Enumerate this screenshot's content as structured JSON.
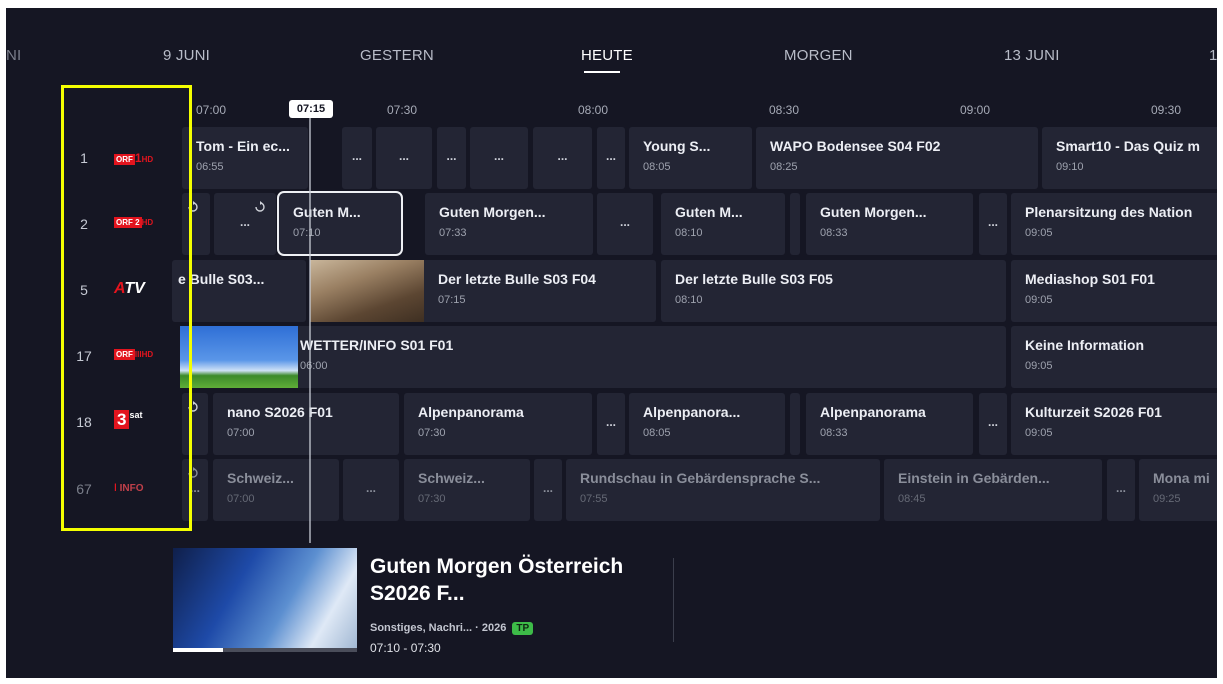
{
  "date_tabs": [
    {
      "label": "NI"
    },
    {
      "label": "9 JUNI"
    },
    {
      "label": "GESTERN"
    },
    {
      "label": "HEUTE",
      "active": true
    },
    {
      "label": "MORGEN"
    },
    {
      "label": "13 JUNI"
    },
    {
      "label": "1"
    }
  ],
  "timeline": {
    "current_time": "07:15",
    "ticks": [
      "07:00",
      "07:30",
      "08:00",
      "08:30",
      "09:00",
      "09:30"
    ]
  },
  "channels": [
    {
      "number": "1",
      "logo_text": "ORF 1 HD"
    },
    {
      "number": "2",
      "logo_text": "ORF 2 HD"
    },
    {
      "number": "5",
      "logo_text": "ATV"
    },
    {
      "number": "17",
      "logo_text": "ORF III HD"
    },
    {
      "number": "18",
      "logo_text": "3sat"
    },
    {
      "number": "67",
      "logo_text": "INFO"
    }
  ],
  "rows": [
    {
      "cells": [
        {
          "title": "Tom - Ein ec...",
          "time": "06:55"
        },
        {
          "title": "..."
        },
        {
          "title": "..."
        },
        {
          "title": "..."
        },
        {
          "title": "..."
        },
        {
          "title": "..."
        },
        {
          "title": "..."
        },
        {
          "title": "Young S...",
          "time": "08:05"
        },
        {
          "title": "WAPO Bodensee S04 F02",
          "time": "08:25"
        },
        {
          "title": "Smart10 - Das Quiz m",
          "time": "09:10"
        }
      ]
    },
    {
      "cells": [
        {
          "title": "..."
        },
        {
          "title": "Guten M...",
          "time": "07:10",
          "selected": true
        },
        {
          "title": "Guten Morgen...",
          "time": "07:33"
        },
        {
          "title": "..."
        },
        {
          "title": "Guten M...",
          "time": "08:10"
        },
        {
          "title": "Guten Morgen...",
          "time": "08:33"
        },
        {
          "title": "..."
        },
        {
          "title": "Plenarsitzung des Nation",
          "time": "09:05"
        }
      ]
    },
    {
      "cells": [
        {
          "title": "e Bulle S03..."
        },
        {
          "title": "Der letzte Bulle S03 F04",
          "time": "07:15"
        },
        {
          "title": "Der letzte Bulle S03 F05",
          "time": "08:10"
        },
        {
          "title": "Mediashop S01 F01",
          "time": "09:05"
        }
      ]
    },
    {
      "cells": [
        {
          "title": "WETTER/INFO S01 F01",
          "time": "06:00"
        },
        {
          "title": "Keine Information",
          "time": "09:05"
        }
      ]
    },
    {
      "cells": [
        {
          "title": "nano S2026 F01",
          "time": "07:00"
        },
        {
          "title": "Alpenpanorama",
          "time": "07:30"
        },
        {
          "title": "..."
        },
        {
          "title": "Alpenpanora...",
          "time": "08:05"
        },
        {
          "title": "Alpenpanorama",
          "time": "08:33"
        },
        {
          "title": "..."
        },
        {
          "title": "Kulturzeit S2026 F01",
          "time": "09:05"
        }
      ]
    },
    {
      "cells": [
        {
          "title": "..."
        },
        {
          "title": "Schweiz...",
          "time": "07:00"
        },
        {
          "title": "..."
        },
        {
          "title": "Schweiz...",
          "time": "07:30"
        },
        {
          "title": "..."
        },
        {
          "title": "Rundschau in Gebärdensprache S...",
          "time": "07:55"
        },
        {
          "title": "Einstein in Gebärden...",
          "time": "08:45"
        },
        {
          "title": "..."
        },
        {
          "title": "Mona mi",
          "time": "09:25"
        }
      ]
    }
  ],
  "detail": {
    "title": "Guten Morgen Österreich S2026 F...",
    "meta": "Sonstiges, Nachri... · 2026",
    "badge": "TP",
    "time_range": "07:10 - 07:30",
    "progress": 0.27
  },
  "colors": {
    "background": "#151623",
    "cell": "#232534",
    "highlight": "#f4ff00",
    "badge_green": "#3dbb48",
    "orf_red": "#e3141e"
  }
}
